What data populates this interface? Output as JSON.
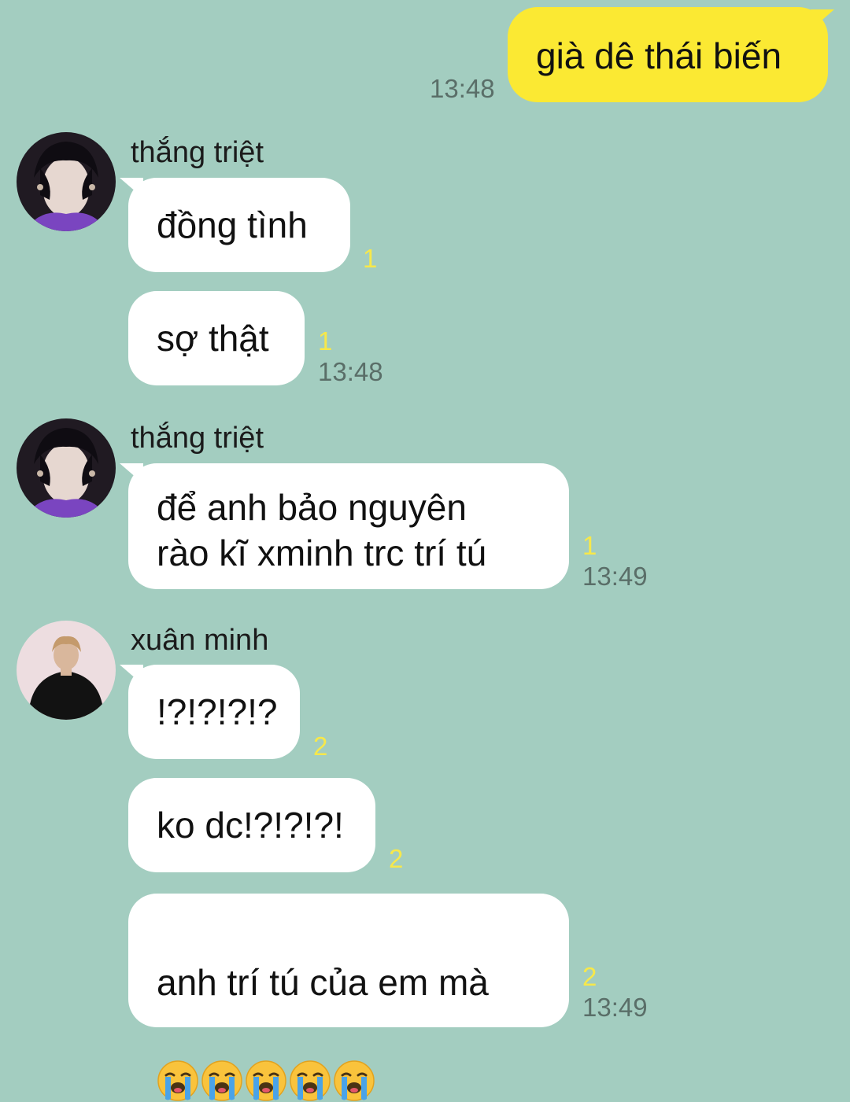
{
  "messages": [
    {
      "sender": "me",
      "text": "già dê thái biến",
      "time": "13:48"
    },
    {
      "sender": "thắng triệt",
      "text": "đồng tình",
      "unread": "1"
    },
    {
      "text": "sợ thật",
      "unread": "1",
      "time": "13:48"
    },
    {
      "sender": "thắng triệt",
      "text": "để anh bảo nguyên\nrào kĩ xminh trc trí tú",
      "unread": "1",
      "time": "13:49"
    },
    {
      "sender": "xuân minh",
      "text": "!?!?!?!?",
      "unread": "2"
    },
    {
      "text": "ko dc!?!?!?!",
      "unread": "2"
    },
    {
      "text": "anh trí tú của em mà",
      "emoji": "loudly-crying-face",
      "emoji_count": 5,
      "unread": "2",
      "time": "13:49"
    }
  ],
  "colors": {
    "background": "#a3cdc0",
    "outgoing_bubble": "#fbe933",
    "incoming_bubble": "#ffffff",
    "unread_count": "#f7e84a",
    "timestamp": "#5a6e68"
  }
}
